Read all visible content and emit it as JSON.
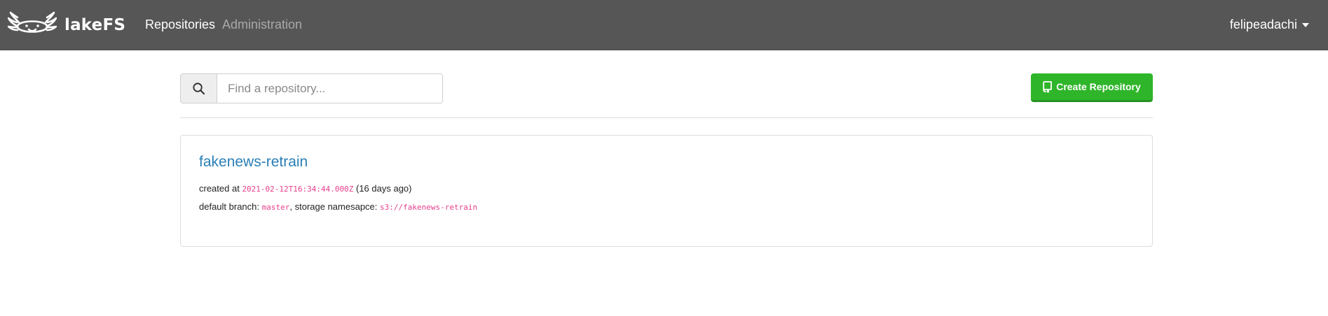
{
  "navbar": {
    "brand_name": "lakeFS",
    "links": [
      {
        "label": "Repositories",
        "active": true
      },
      {
        "label": "Administration",
        "active": false
      }
    ],
    "user": "felipeadachi"
  },
  "search": {
    "placeholder": "Find a repository...",
    "value": "",
    "icon": "search-icon"
  },
  "toolbar": {
    "create_label": "Create Repository",
    "create_icon": "repo-icon"
  },
  "repositories": [
    {
      "name": "fakenews-retrain",
      "created_prefix": "created at ",
      "created_at": "2021-02-12T16:34:44.000Z",
      "created_relative": " (16 days ago)",
      "branch_prefix": "default branch: ",
      "default_branch": "master",
      "namespace_prefix": ", storage namesapce: ",
      "storage_namespace": "s3://fakenews-retrain"
    }
  ],
  "colors": {
    "navbar": "#565656",
    "primary_button": "#2fb52a",
    "link": "#2a7fb5",
    "code": "#e83e8c"
  }
}
